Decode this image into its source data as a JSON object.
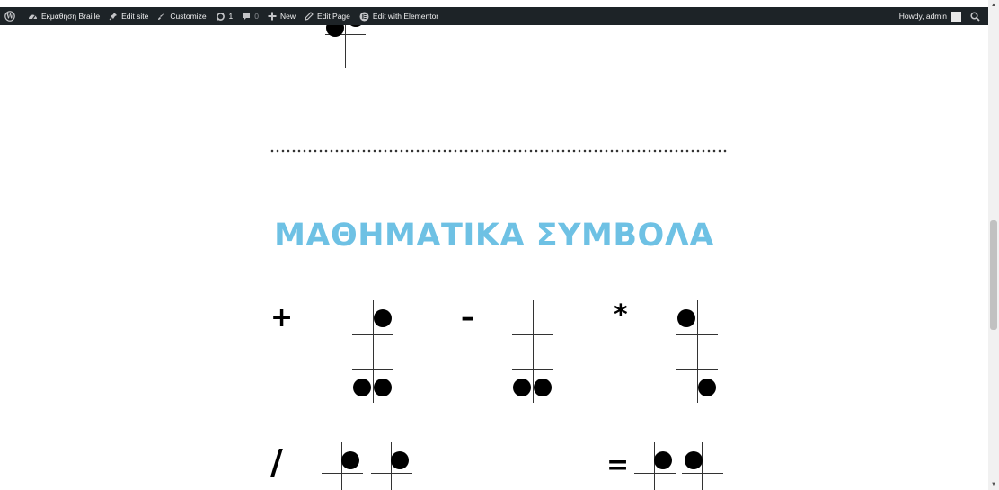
{
  "adminbar": {
    "site_name": "Εκμάθηση Braille",
    "edit_site": "Edit site",
    "customize": "Customize",
    "updates_count": "1",
    "comments_count": "0",
    "new_label": "New",
    "edit_page": "Edit Page",
    "edit_elementor": "Edit with Elementor",
    "howdy": "Howdy, admin"
  },
  "content": {
    "section_heading": "ΜΑΘΗΜΑΤΙΚΑ ΣΥΜΒΟΛΑ",
    "symbols": {
      "plus": "+",
      "minus": "–",
      "asterisk": "*",
      "slash": "/",
      "equals": "="
    }
  },
  "colors": {
    "adminbar_bg": "#1d2327",
    "heading": "#6ec1e4"
  }
}
